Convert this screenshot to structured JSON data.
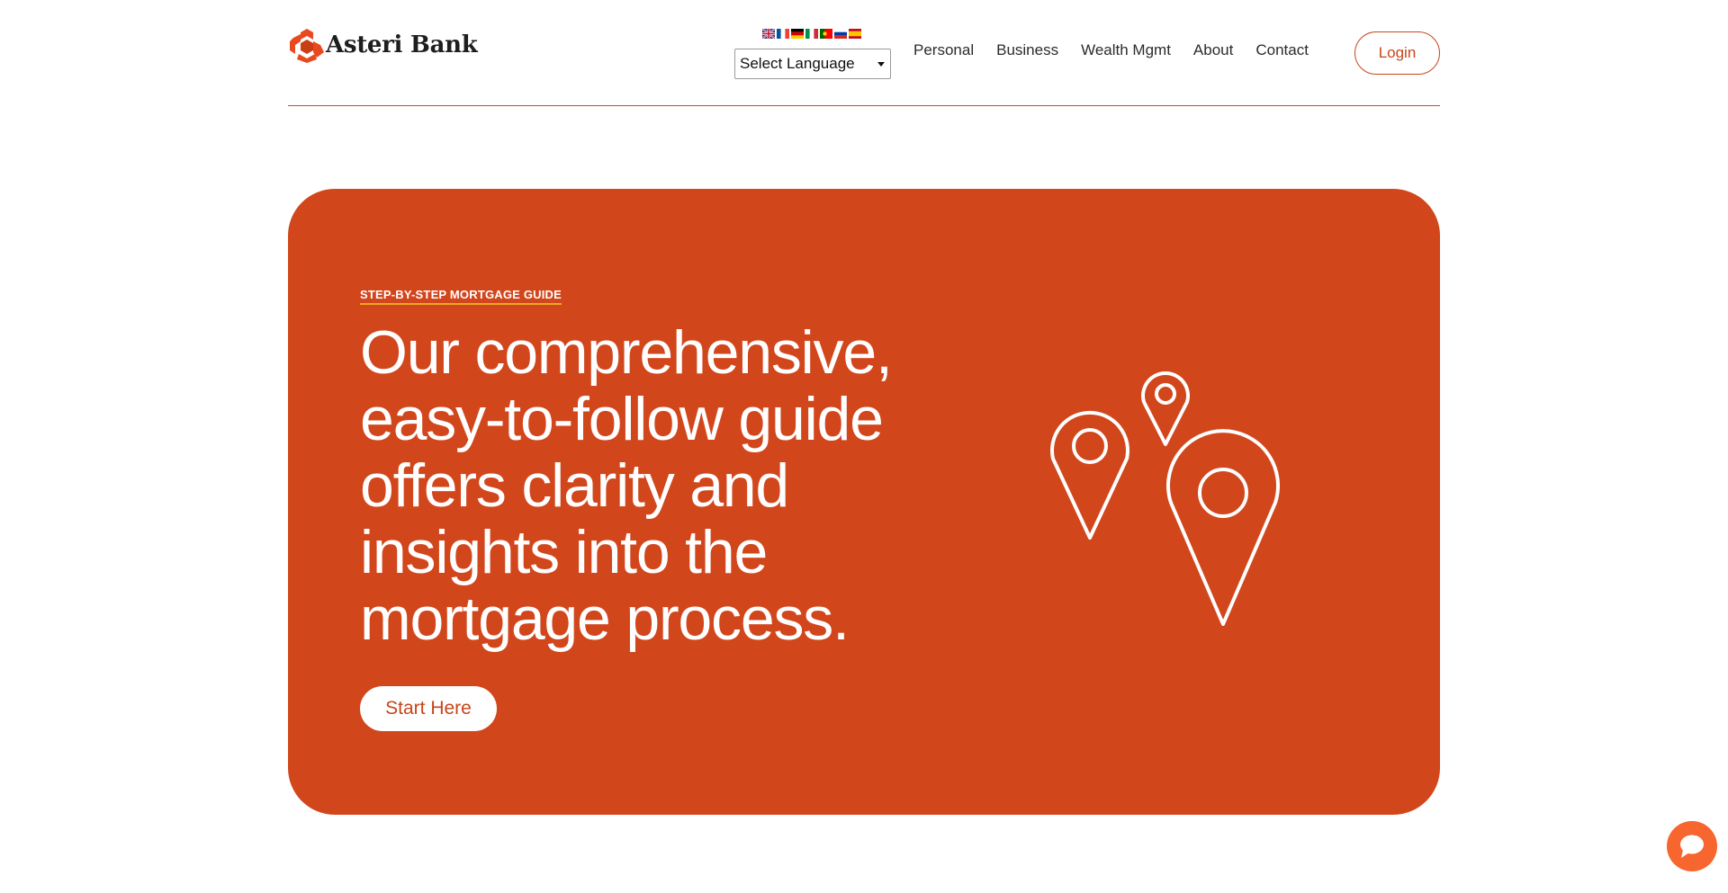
{
  "brand": {
    "name": "Asteri Bank",
    "logo_color": "#e8491e"
  },
  "language": {
    "flags": [
      "uk-flag-icon",
      "fr-flag-icon",
      "de-flag-icon",
      "it-flag-icon",
      "pt-flag-icon",
      "ru-flag-icon",
      "es-flag-icon"
    ],
    "select_label": "Select Language"
  },
  "nav": {
    "items": [
      {
        "label": "Personal"
      },
      {
        "label": "Business"
      },
      {
        "label": "Wealth Mgmt"
      },
      {
        "label": "About"
      },
      {
        "label": "Contact"
      }
    ],
    "login_label": "Login"
  },
  "hero": {
    "eyebrow": "STEP-BY-STEP MORTGAGE GUIDE",
    "headline": "Our comprehensive, easy-to-follow guide offers clarity and insights into the mortgage process.",
    "cta_label": "Start Here",
    "background": "#d2461c",
    "illustration": "map-pins-icon"
  },
  "chat": {
    "icon": "chat-bubble-icon",
    "color": "#f7662e"
  }
}
